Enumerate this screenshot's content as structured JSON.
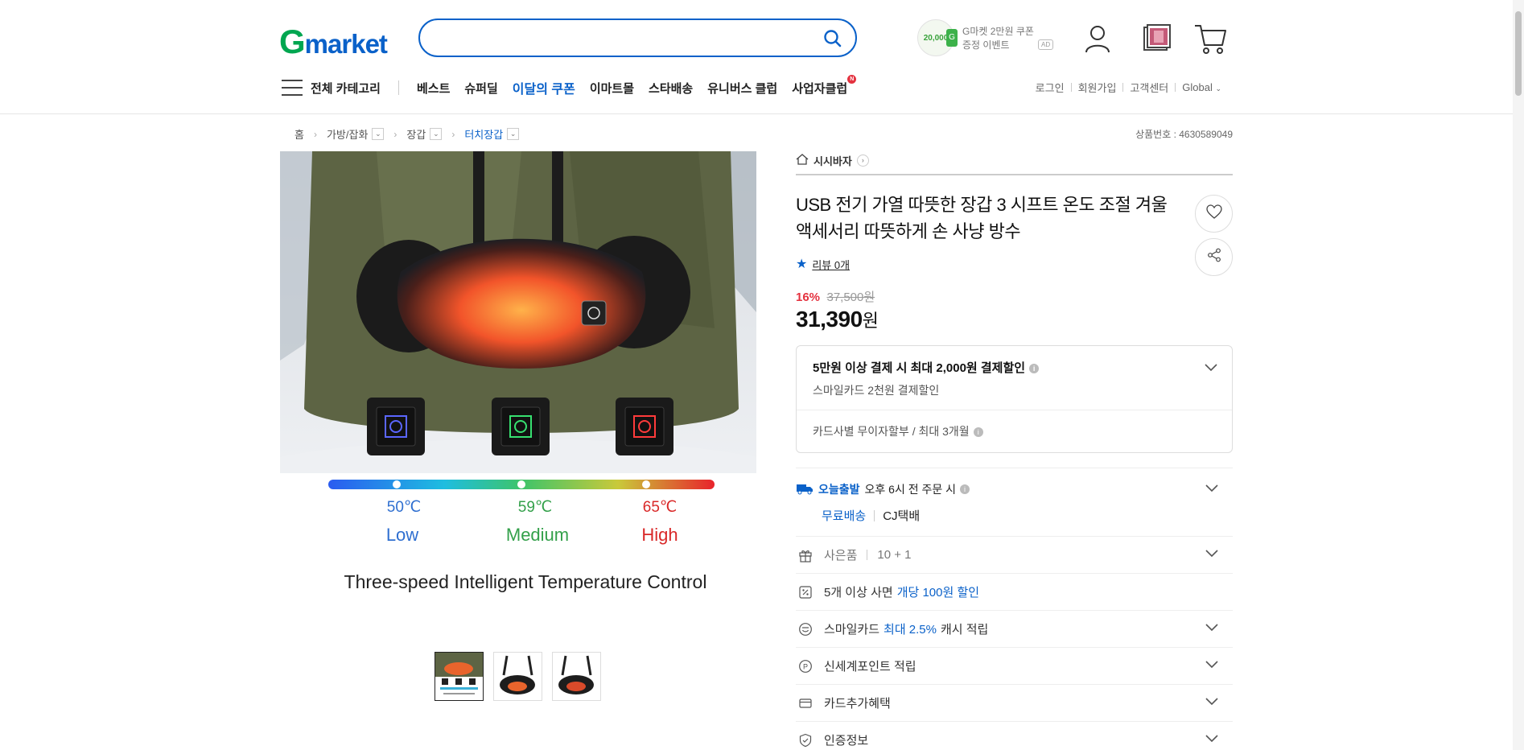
{
  "header": {
    "logo_g": "G",
    "logo_rest": "market",
    "search_placeholder": "",
    "promo": {
      "coin": "20,000",
      "coin_badge": "G",
      "line1": "G마켓 2만원 쿠폰",
      "line2": "증정 이벤트",
      "ad": "AD"
    }
  },
  "nav": {
    "all_categories": "전체 카테고리",
    "items": [
      "베스트",
      "슈퍼딜",
      "이달의 쿠폰",
      "이마트몰",
      "스타배송",
      "유니버스 클럽",
      "사업자클럽"
    ],
    "badge": "N",
    "util": [
      "로그인",
      "회원가입",
      "고객센터",
      "Global"
    ]
  },
  "breadcrumb": {
    "home": "홈",
    "c1": "가방/잡화",
    "c2": "장갑",
    "c3": "터치장갑"
  },
  "product_number": "상품번호 : 4630589049",
  "image": {
    "temps": [
      "50℃",
      "59℃",
      "65℃"
    ],
    "levels": [
      "Low",
      "Medium",
      "High"
    ],
    "caption": "Three-speed Intelligent Temperature Control"
  },
  "product": {
    "shop": "시시바자",
    "title": "USB 전기 가열 따뜻한 장갑 3 시프트 온도 조절 겨울 액세서리 따뜻하게 손 사냥 방수",
    "review": "리뷰 0개",
    "discount": "16%",
    "original_price": "37,500원",
    "price": "31,390",
    "price_unit": "원"
  },
  "benefit": {
    "title": "5만원 이상 결제 시 최대 2,000원 결제할인",
    "sub": "스마일카드 2천원 결제할인",
    "installment": "카드사별 무이자할부 / 최대 3개월"
  },
  "shipping": {
    "today": "오늘출발",
    "cutoff": "오후 6시 전 주문 시",
    "free": "무료배송",
    "carrier": "CJ택배"
  },
  "rows": {
    "gift_label": "사은품",
    "gift_value": "10 + 1",
    "bulk_prefix": "5개 이상 사면",
    "bulk_highlight": "개당 100원 할인",
    "smile_prefix": "스마일카드",
    "smile_highlight": "최대 2.5%",
    "smile_suffix": "캐시 적립",
    "point": "신세계포인트 적립",
    "card": "카드추가혜택",
    "cert": "인증정보"
  },
  "colors": {
    "brand_blue": "#0a61c9",
    "brand_green": "#00a650",
    "sale_red": "#e4323f"
  }
}
